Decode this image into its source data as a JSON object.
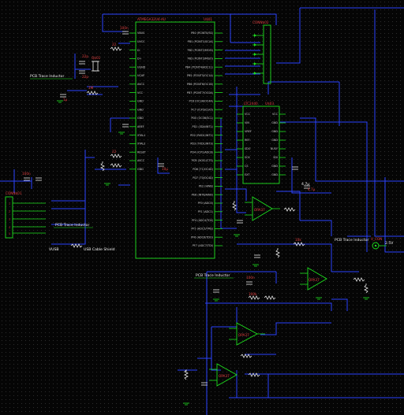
{
  "components": {
    "mcu": {
      "name": "ATMEGA32U4-AU",
      "ref": "U$01"
    },
    "latch": {
      "name": "LTC2440",
      "ref": "U$03"
    },
    "conn_top": {
      "ref": "CONN$02"
    },
    "conn_left": {
      "ref": "CONN$01"
    },
    "conn_right": {
      "ref": "V_CON"
    },
    "opa1": {
      "name": "OPA37"
    },
    "opa2": {
      "name": "OPA37"
    },
    "opa3": {
      "name": "OPA37"
    },
    "opa4": {
      "name": "OPA37"
    },
    "crystal": {
      "ref": "Q$01"
    }
  },
  "net_labels": {
    "pcb_trace_1": "PCB Trace Inductor",
    "pcb_trace_2": "PCB Trace Inductor",
    "pcb_trace_3": "PCB Trace Inductor",
    "pcb_trace_4": "PCB Trace Inductor",
    "usb_shield": "USB Cable Shield",
    "vusb": "VUSB",
    "vbus": "VBus",
    "gnd": "GND",
    "vcc": "4.7µ",
    "ref_out": "2.5V"
  },
  "mcu_pins_left": [
    "VBUS",
    "UVCC",
    "D-",
    "D+",
    "UGND",
    "UCAP",
    "AVCC",
    "VCC",
    "GND",
    "GND",
    "GND",
    "AREF",
    "XTAL1",
    "XTAL2",
    "RESET",
    "AVCC",
    "GND"
  ],
  "mcu_pins_right": [
    "PB0 (PCINT0/SS)",
    "PB1 (PCINT1/SCLK)",
    "PB2 (PCINT2/MOSI)",
    "PB3 (PCINT3/MISO)",
    "PB4 (PCINT4/ADC11)",
    "PB5 (PCINT5/OC1A)",
    "PB6 (PCINT6/OC1B)",
    "PB7 (PCINT7/OC0A)",
    "PC6 (OC3A/OC4A)",
    "PC7 (ICP3/CLK0)",
    "PD0 (OC0B/SCL)",
    "PD1 (SDA/INT1)",
    "PD2 (RXD1/INT2)",
    "PD3 (TXD1/INT3)",
    "PD4 (ICP1/ADC8)",
    "PD5 (XCK1/CTS)",
    "PD6 (T1/OC4D)",
    "PD7 (T0/OC4D)",
    "PE2 (HWB)",
    "PE6 (INT6/AIN0)",
    "PF0 (ADC0)",
    "PF1 (ADC1)",
    "PF4 (ADC4/TCK)",
    "PF5 (ADC5/TMS)",
    "PF6 (ADC6/TDO)",
    "PF7 (ADC7/TDI)"
  ],
  "latch_pins_left": [
    "VCC",
    "VIN",
    "VREF",
    "REF-",
    "SDO",
    "SCK",
    "CS",
    "EXT"
  ],
  "latch_pins_right": [
    "VCC",
    "GND",
    "GND",
    "GND",
    "BUSY",
    "SDI",
    "GND",
    "GND"
  ],
  "passives": {
    "r1": "1M",
    "r2": "22",
    "r3": "22",
    "r4": "10k",
    "r5": "100k",
    "c1": "22p",
    "c2": "22p",
    "c3": "1µ",
    "c4": "100n",
    "c5": "10µ",
    "c6": "100n",
    "c7": "4.7µ",
    "c8": "100n",
    "r6": "10k",
    "r7": "10k"
  }
}
